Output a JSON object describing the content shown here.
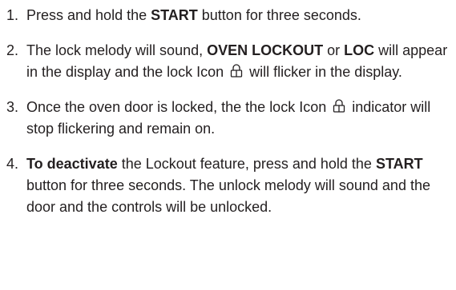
{
  "steps": [
    {
      "number": "1.",
      "t1": "Press and hold the ",
      "b1": "START",
      "t2": " button for three seconds."
    },
    {
      "number": "2.",
      "t1": "The lock melody will sound, ",
      "b1": "OVEN LOCKOUT",
      "t2": " or ",
      "b2": "LOC",
      "t3": " will appear in the display and the lock Icon",
      "icon": "padlock-icon",
      "t4": " will flicker in the display."
    },
    {
      "number": "3.",
      "t1": "Once the oven door is locked, the the lock Icon",
      "icon": "padlock-icon",
      "t2": " indicator will stop flickering and remain on."
    },
    {
      "number": "4.",
      "b1": "To deactivate",
      "t1": " the Lockout feature, press and hold the ",
      "b2": "START",
      "t2": " button for three seconds. The unlock melody will sound and the door and the controls will be unlocked."
    }
  ],
  "colors": {
    "text": "#231f20",
    "background": "#ffffff"
  }
}
